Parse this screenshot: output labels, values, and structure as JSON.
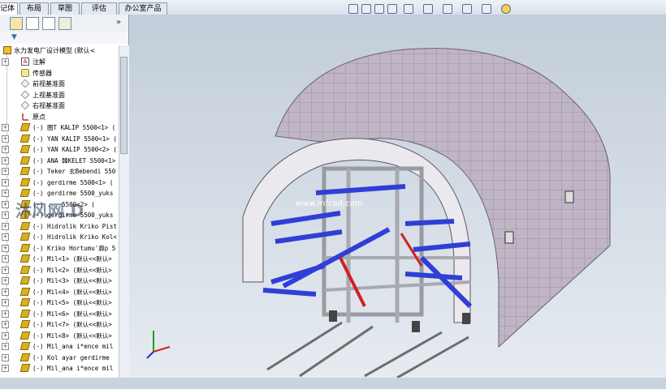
{
  "tabs": [
    "记体",
    "布局",
    "草图",
    "评估",
    "办公室产品"
  ],
  "panel": {
    "more": "»",
    "root_label": "水力发电厂设计模型  (默认<",
    "items": [
      {
        "type": "note",
        "label": "注解",
        "exp": "+"
      },
      {
        "type": "sensor",
        "label": "传感器",
        "exp": ""
      },
      {
        "type": "plane",
        "label": "前视基准面",
        "exp": ""
      },
      {
        "type": "plane",
        "label": "上视基准面",
        "exp": ""
      },
      {
        "type": "plane",
        "label": "右视基准面",
        "exp": ""
      },
      {
        "type": "origin",
        "label": "原点",
        "exp": ""
      },
      {
        "type": "part",
        "label": "(-) 圈T KALIP 5500<1> (",
        "exp": "+"
      },
      {
        "type": "part",
        "label": "(-) YAN KALIP 5500<1> (",
        "exp": "+"
      },
      {
        "type": "part",
        "label": "(-) YAN KALIP 5500<2> (",
        "exp": "+"
      },
      {
        "type": "part",
        "label": "(-) ANA 韓KELET 5500<1>",
        "exp": "+"
      },
      {
        "type": "part",
        "label": "(-) Teker 玄Bebendi 550",
        "exp": "+"
      },
      {
        "type": "part",
        "label": "(-) gerdirme  5500<1> (",
        "exp": "+"
      },
      {
        "type": "part",
        "label": "(-) gerdirme  5500_yuks",
        "exp": "+"
      },
      {
        "type": "part",
        "label": "(-) ...  5500<2> (",
        "exp": "+"
      },
      {
        "type": "part",
        "label": "(-) gerdirme  5500_yuks",
        "exp": "+"
      },
      {
        "type": "part",
        "label": "(-) Hidrolik Kriko Pist",
        "exp": "+"
      },
      {
        "type": "part",
        "label": "(-) Hidrolik Kriko Kol<",
        "exp": "+"
      },
      {
        "type": "part",
        "label": "(-) Kriko Hortumu'廊p 5",
        "exp": "+"
      },
      {
        "type": "part",
        "label": "(-) Mil<1> (默认<<默认>",
        "exp": "+"
      },
      {
        "type": "part",
        "label": "(-) Mil<2> (默认<<默认>",
        "exp": "+"
      },
      {
        "type": "part",
        "label": "(-) Mil<3> (默认<<默认>",
        "exp": "+"
      },
      {
        "type": "part",
        "label": "(-) Mil<4> (默认<<默认>",
        "exp": "+"
      },
      {
        "type": "part",
        "label": "(-) Mil<5> (默认<<默认>",
        "exp": "+"
      },
      {
        "type": "part",
        "label": "(-) Mil<6> (默认<<默认>",
        "exp": "+"
      },
      {
        "type": "part",
        "label": "(-) Mil<7> (默认<<默认>",
        "exp": "+"
      },
      {
        "type": "part",
        "label": "(-) Mil<8> (默认<<默认>",
        "exp": "+"
      },
      {
        "type": "part",
        "label": "(-) Mil_ana i*ence mil",
        "exp": "+"
      },
      {
        "type": "part",
        "label": "(-) Kol ayar gerdirme",
        "exp": "+"
      },
      {
        "type": "part",
        "label": "(-) Mil_ana i*ence mil",
        "exp": "+"
      }
    ]
  },
  "viewport": {
    "watermark": "沐风网.D",
    "url_watermark": "www.mfcad.com"
  },
  "colors": {
    "shell": "#b9aebd",
    "frame": "#e8e8ea",
    "beam": "#2f3fd6",
    "red": "#d02020"
  }
}
